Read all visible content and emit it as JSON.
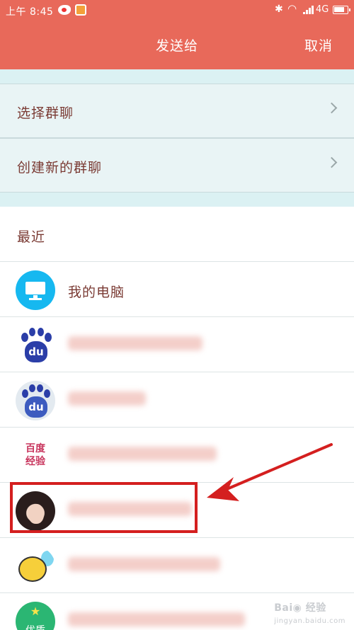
{
  "status_bar": {
    "time": "上午 8:45",
    "network": "4G",
    "battery_level": 0.8
  },
  "header": {
    "title": "发送给",
    "cancel_label": "取消"
  },
  "options": [
    {
      "label": "选择群聊"
    },
    {
      "label": "创建新的群聊"
    }
  ],
  "recent": {
    "section_label": "最近",
    "contacts": [
      {
        "name": "我的电脑",
        "avatar": "computer-icon"
      },
      {
        "name": "",
        "avatar": "baidu-paw-logo",
        "blurred": true
      },
      {
        "name": "",
        "avatar": "baidu-paw-logo",
        "blurred": true
      },
      {
        "name": "",
        "avatar": "baidu-jingyan-logo",
        "avatar_text": "百度经验",
        "blurred": true
      },
      {
        "name": "",
        "avatar": "user-photo",
        "blurred": true,
        "highlighted": true
      },
      {
        "name": "",
        "avatar": "chick-icon",
        "blurred": true
      },
      {
        "name": "",
        "avatar": "youzhi-badge",
        "avatar_text": "优质",
        "blurred": true
      }
    ]
  },
  "colors": {
    "header_bg": "#e8695a",
    "annotation_red": "#d41f1f"
  }
}
